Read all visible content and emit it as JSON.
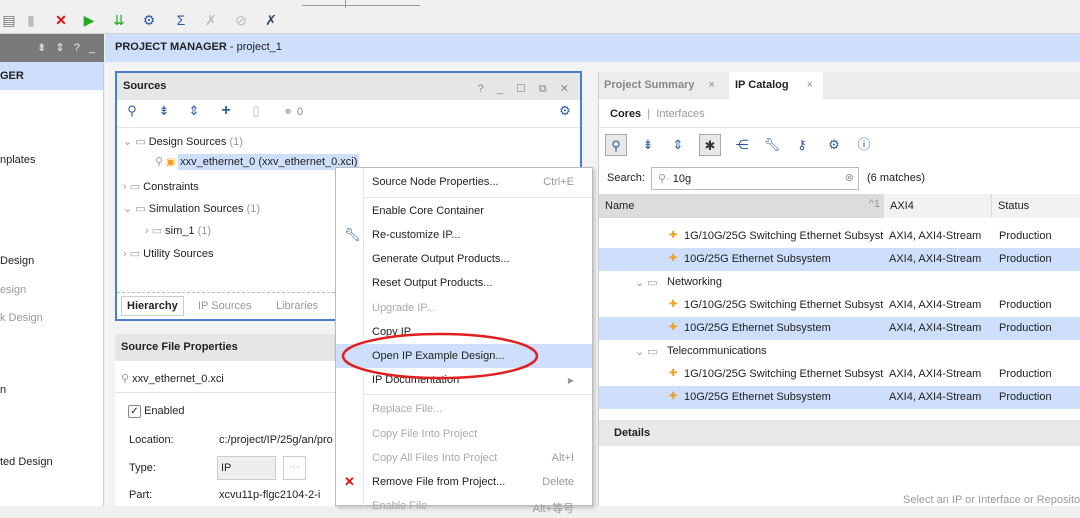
{
  "toolbar": {
    "icons": [
      "copy-icon",
      "paste-icon",
      "delete-icon",
      "run-icon",
      "download-icon",
      "settings-icon",
      "sigma-icon",
      "disabled-icon",
      "disabled-icon",
      "cross-icon"
    ]
  },
  "left": {
    "header_icons": "⇟ ⇕ ? _",
    "items": [
      {
        "label": "GER"
      },
      {
        "label": "nplates"
      },
      {
        "label": "Design"
      },
      {
        "label": "esign"
      },
      {
        "label": "k Design"
      },
      {
        "label": "n"
      },
      {
        "label": "ted Design"
      }
    ]
  },
  "header": {
    "title": "PROJECT MANAGER",
    "project": " - project_1"
  },
  "sources": {
    "title": "Sources",
    "header_buttons": "? _ ☐ ⧉ ✕",
    "count": "0",
    "tree": [
      {
        "label": "Design Sources",
        "count": "(1)"
      },
      {
        "label": "xxv_ethernet_0 (xxv_ethernet_0.xci)"
      },
      {
        "label": "Constraints"
      },
      {
        "label": "Simulation Sources",
        "count": "(1)"
      },
      {
        "label": "sim_1",
        "count": "(1)"
      },
      {
        "label": "Utility Sources"
      }
    ],
    "tabs": [
      "Hierarchy",
      "IP Sources",
      "Libraries"
    ]
  },
  "props": {
    "title": "Source File Properties",
    "file": "xxv_ethernet_0.xci",
    "enabled": "Enabled",
    "location_label": "Location:",
    "location": "c:/project/IP/25g/an/pro",
    "type_label": "Type:",
    "type": "IP",
    "more": "···",
    "part_label": "Part:",
    "part": "xcvu11p-flgc2104-2-i"
  },
  "menu": {
    "items": [
      {
        "label": "Source Node Properties...",
        "shortcut": "Ctrl+E"
      },
      {
        "label": "Enable Core Container"
      },
      {
        "label": "Re-customize IP..."
      },
      {
        "label": "Generate Output Products..."
      },
      {
        "label": "Reset Output Products..."
      },
      {
        "label": "Upgrade IP..."
      },
      {
        "label": "Copy IP..."
      },
      {
        "label": "Open IP Example Design..."
      },
      {
        "label": "IP Documentation"
      },
      {
        "label": "Replace File..."
      },
      {
        "label": "Copy File Into Project"
      },
      {
        "label": "Copy All Files Into Project",
        "shortcut": "Alt+I"
      },
      {
        "label": "Remove File from Project...",
        "shortcut": "Delete"
      },
      {
        "label": "Enable File",
        "shortcut": "Alt+等号"
      }
    ]
  },
  "catalog": {
    "tabs": [
      "Project Summary",
      "IP Catalog"
    ],
    "subtabs": [
      "Cores",
      "Interfaces"
    ],
    "search_label": "Search:",
    "search_value": "10g",
    "matches": "(6 matches)",
    "columns": [
      "Name",
      "AXI4",
      "Status"
    ],
    "sort": "^1",
    "rows": [
      {
        "type": "ip",
        "name": "1G/10G/25G Switching Ethernet Subsystem",
        "axi": "AXI4, AXI4-Stream",
        "status": "Production"
      },
      {
        "type": "ip",
        "name": "10G/25G Ethernet Subsystem",
        "axi": "AXI4, AXI4-Stream",
        "status": "Production",
        "sel": true
      },
      {
        "type": "group",
        "name": "Networking"
      },
      {
        "type": "ip",
        "name": "1G/10G/25G Switching Ethernet Subsystem",
        "axi": "AXI4, AXI4-Stream",
        "status": "Production"
      },
      {
        "type": "ip",
        "name": "10G/25G Ethernet Subsystem",
        "axi": "AXI4, AXI4-Stream",
        "status": "Production",
        "sel": true
      },
      {
        "type": "group",
        "name": "Telecommunications"
      },
      {
        "type": "ip",
        "name": "1G/10G/25G Switching Ethernet Subsystem",
        "axi": "AXI4, AXI4-Stream",
        "status": "Production"
      },
      {
        "type": "ip",
        "name": "10G/25G Ethernet Subsystem",
        "axi": "AXI4, AXI4-Stream",
        "status": "Production",
        "sel": true
      }
    ],
    "details_title": "Details",
    "details_hint": "Select an IP or Interface or Reposito"
  }
}
